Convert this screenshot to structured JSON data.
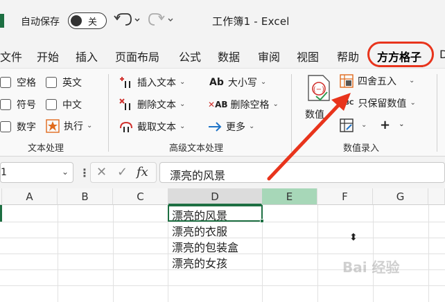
{
  "titlebar": {
    "autosave_label": "自动保存",
    "autosave_state": "关",
    "doc_title": "工作簿1 - Excel"
  },
  "menu": {
    "tabs": [
      "文件",
      "开始",
      "插入",
      "页面布局",
      "公式",
      "数据",
      "审阅",
      "视图",
      "帮助",
      "方方格子",
      "D"
    ],
    "active_tab": "方方格子"
  },
  "ribbon": {
    "text_group": {
      "label": "文本处理",
      "items": [
        "空格",
        "英文",
        "符号",
        "中文",
        "数字",
        "执行"
      ]
    },
    "advanced_group": {
      "label": "高级文本处理",
      "items": [
        "插入文本",
        "删除文本",
        "截取文本",
        "大小写",
        "删除空格",
        "更多"
      ]
    },
    "number_group": {
      "label": "数值录入",
      "big_button": "数值",
      "items": [
        "四舍五入",
        "只保留数值"
      ],
      "plus": "+"
    }
  },
  "formula_bar": {
    "name_box": "1",
    "fx": "fx",
    "content": "漂亮的风景"
  },
  "grid": {
    "columns": [
      "A",
      "B",
      "C",
      "D",
      "E",
      "F",
      "G"
    ],
    "cells_d": [
      "漂亮的风景",
      "漂亮的衣服",
      "漂亮的包装盒",
      "漂亮的女孩"
    ]
  },
  "watermark": "Bai 经验",
  "colors": {
    "excel_green": "#1d6f42",
    "annotation_red": "#e8341c"
  }
}
